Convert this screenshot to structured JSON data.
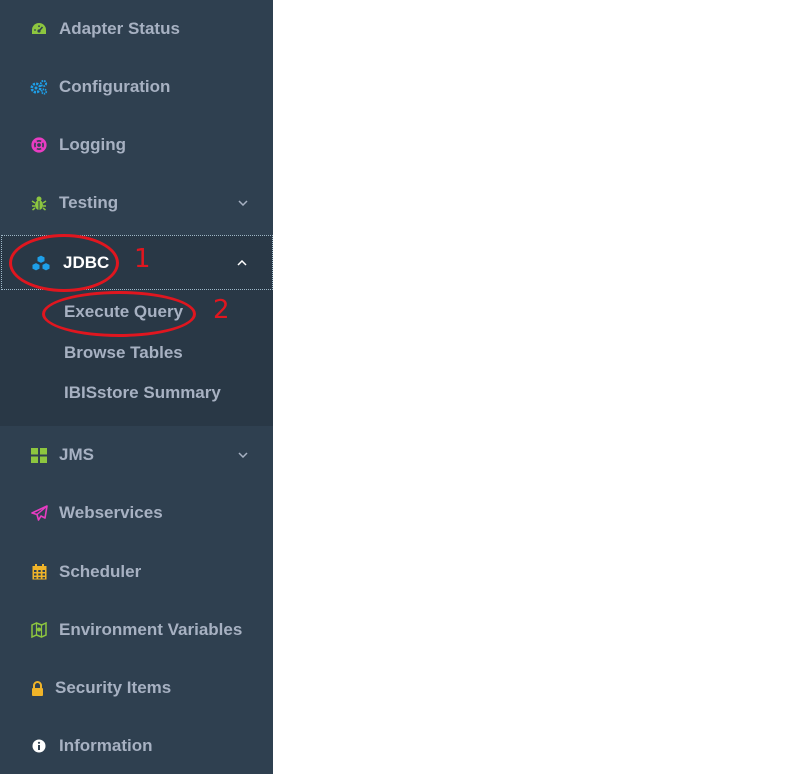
{
  "sidebar": {
    "items_top": [
      {
        "label": "Adapter Status",
        "icon": "dashboard-icon",
        "color": "#8dc63f"
      },
      {
        "label": "Configuration",
        "icon": "cogs-icon",
        "color": "#1e9fe8"
      },
      {
        "label": "Logging",
        "icon": "life-ring-icon",
        "color": "#e83cc2"
      },
      {
        "label": "Testing",
        "icon": "bug-icon",
        "color": "#8dc63f"
      }
    ],
    "jdbc": {
      "label": "JDBC",
      "icon": "cubes-icon",
      "color": "#1e9fe8",
      "sub_items": [
        "Execute Query",
        "Browse Tables",
        "IBISstore Summary"
      ]
    },
    "items_bottom": [
      {
        "label": "JMS",
        "icon": "th-large-icon",
        "color": "#8dc63f"
      },
      {
        "label": "Webservices",
        "icon": "paper-plane-icon",
        "color": "#e83cc2"
      },
      {
        "label": "Scheduler",
        "icon": "calendar-icon",
        "color": "#f0b429"
      },
      {
        "label": "Environment Variables",
        "icon": "map-icon",
        "color": "#8dc63f"
      },
      {
        "label": "Security Items",
        "icon": "lock-icon",
        "color": "#f0b429"
      },
      {
        "label": "Information",
        "icon": "info-circle-icon",
        "color": "#ffffff"
      }
    ]
  },
  "annotations": {
    "first": "1",
    "second": "2"
  }
}
